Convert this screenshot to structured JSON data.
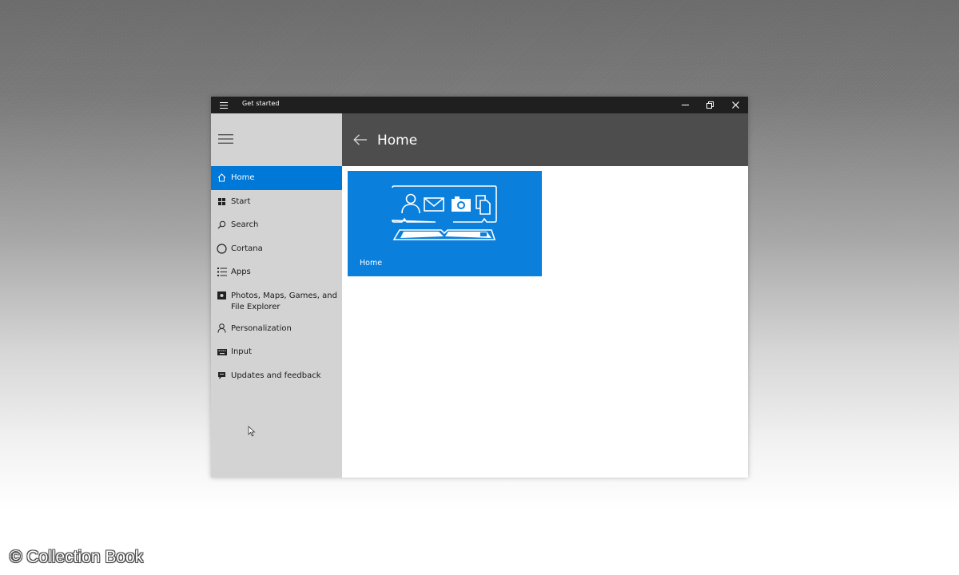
{
  "window": {
    "title": "Get started"
  },
  "header": {
    "title": "Home"
  },
  "nav": {
    "items": [
      {
        "label": "Home",
        "icon": "home-icon",
        "selected": true
      },
      {
        "label": "Start",
        "icon": "start-grid-icon"
      },
      {
        "label": "Search",
        "icon": "search-icon"
      },
      {
        "label": "Cortana",
        "icon": "cortana-circle-icon"
      },
      {
        "label": "Apps",
        "icon": "apps-list-icon"
      },
      {
        "label": "Photos, Maps, Games, and File Explorer",
        "icon": "photo-icon"
      },
      {
        "label": "Personalization",
        "icon": "person-icon"
      },
      {
        "label": "Input",
        "icon": "keyboard-icon"
      },
      {
        "label": "Updates and feedback",
        "icon": "feedback-icon"
      }
    ]
  },
  "content": {
    "tiles": [
      {
        "label": "Home",
        "icon": "home-illustration-icon"
      }
    ]
  },
  "colors": {
    "accent": "#0078d7",
    "titlebar": "#1f1f1f",
    "header": "#4d4d4d",
    "nav_bg": "#d3d3d3"
  },
  "watermark": {
    "text": "© Collection Book"
  }
}
